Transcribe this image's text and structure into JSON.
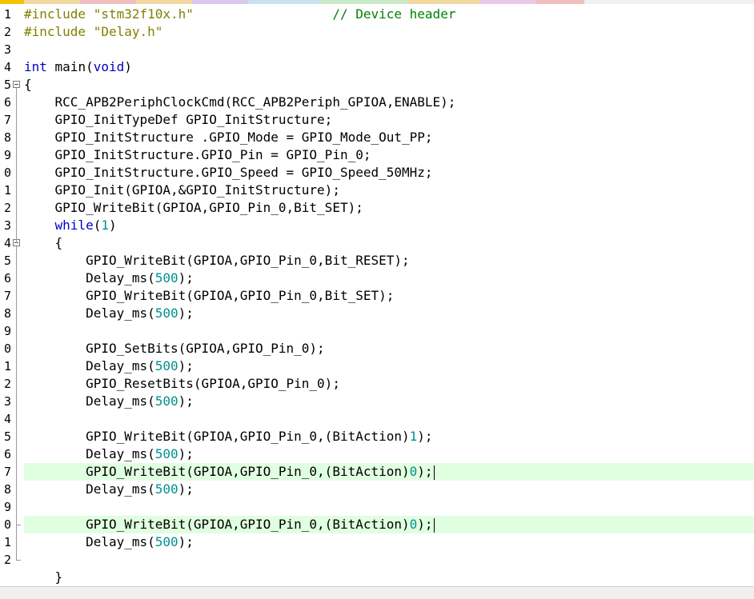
{
  "editor": {
    "lines": [
      {
        "n": "1",
        "parts": [
          {
            "t": "#include ",
            "c": "pp"
          },
          {
            "t": "\"stm32f10x.h\"",
            "c": "str"
          },
          {
            "t": "                  ",
            "c": ""
          },
          {
            "t": "// Device header",
            "c": "cm"
          }
        ]
      },
      {
        "n": "2",
        "parts": [
          {
            "t": "#include ",
            "c": "pp"
          },
          {
            "t": "\"Delay.h\"",
            "c": "str"
          }
        ]
      },
      {
        "n": "3",
        "parts": []
      },
      {
        "n": "4",
        "parts": [
          {
            "t": "int",
            "c": "kw"
          },
          {
            "t": " main(",
            "c": ""
          },
          {
            "t": "void",
            "c": "kw"
          },
          {
            "t": ")",
            "c": ""
          }
        ]
      },
      {
        "n": "5",
        "parts": [
          {
            "t": "{",
            "c": ""
          }
        ]
      },
      {
        "n": "6",
        "parts": [
          {
            "t": "    RCC_APB2PeriphClockCmd(RCC_APB2Periph_GPIOA,ENABLE);",
            "c": ""
          }
        ]
      },
      {
        "n": "7",
        "parts": [
          {
            "t": "    GPIO_InitTypeDef GPIO_InitStructure;",
            "c": ""
          }
        ]
      },
      {
        "n": "8",
        "parts": [
          {
            "t": "    GPIO_InitStructure .GPIO_Mode = GPIO_Mode_Out_PP;",
            "c": ""
          }
        ]
      },
      {
        "n": "9",
        "parts": [
          {
            "t": "    GPIO_InitStructure.GPIO_Pin = GPIO_Pin_0;",
            "c": ""
          }
        ]
      },
      {
        "n": "0",
        "parts": [
          {
            "t": "    GPIO_InitStructure.GPIO_Speed = GPIO_Speed_50MHz;",
            "c": ""
          }
        ]
      },
      {
        "n": "1",
        "parts": [
          {
            "t": "    GPIO_Init(GPIOA,&GPIO_InitStructure);",
            "c": ""
          }
        ]
      },
      {
        "n": "2",
        "parts": [
          {
            "t": "    GPIO_WriteBit(GPIOA,GPIO_Pin_0,Bit_SET);",
            "c": ""
          }
        ]
      },
      {
        "n": "3",
        "parts": [
          {
            "t": "    ",
            "c": ""
          },
          {
            "t": "while",
            "c": "kw"
          },
          {
            "t": "(",
            "c": ""
          },
          {
            "t": "1",
            "c": "num"
          },
          {
            "t": ")",
            "c": ""
          }
        ]
      },
      {
        "n": "4",
        "parts": [
          {
            "t": "    {",
            "c": ""
          }
        ]
      },
      {
        "n": "5",
        "parts": [
          {
            "t": "        GPIO_WriteBit(GPIOA,GPIO_Pin_0,Bit_RESET);",
            "c": ""
          }
        ]
      },
      {
        "n": "6",
        "parts": [
          {
            "t": "        Delay_ms(",
            "c": ""
          },
          {
            "t": "500",
            "c": "num"
          },
          {
            "t": ");",
            "c": ""
          }
        ]
      },
      {
        "n": "7",
        "parts": [
          {
            "t": "        GPIO_WriteBit(GPIOA,GPIO_Pin_0,Bit_SET);",
            "c": ""
          }
        ]
      },
      {
        "n": "8",
        "parts": [
          {
            "t": "        Delay_ms(",
            "c": ""
          },
          {
            "t": "500",
            "c": "num"
          },
          {
            "t": ");",
            "c": ""
          }
        ]
      },
      {
        "n": "9",
        "parts": []
      },
      {
        "n": "0",
        "parts": [
          {
            "t": "        GPIO_SetBits(GPIOA,GPIO_Pin_0);",
            "c": ""
          }
        ]
      },
      {
        "n": "1",
        "parts": [
          {
            "t": "        Delay_ms(",
            "c": ""
          },
          {
            "t": "500",
            "c": "num"
          },
          {
            "t": ");",
            "c": ""
          }
        ]
      },
      {
        "n": "2",
        "parts": [
          {
            "t": "        GPIO_ResetBits(GPIOA,GPIO_Pin_0);",
            "c": ""
          }
        ]
      },
      {
        "n": "3",
        "parts": [
          {
            "t": "        Delay_ms(",
            "c": ""
          },
          {
            "t": "500",
            "c": "num"
          },
          {
            "t": ");",
            "c": ""
          }
        ]
      },
      {
        "n": "4",
        "parts": []
      },
      {
        "n": "5",
        "parts": [
          {
            "t": "        GPIO_WriteBit(GPIOA,GPIO_Pin_0,(BitAction)",
            "c": ""
          },
          {
            "t": "1",
            "c": "num"
          },
          {
            "t": ");",
            "c": ""
          }
        ]
      },
      {
        "n": "6",
        "parts": [
          {
            "t": "        Delay_ms(",
            "c": ""
          },
          {
            "t": "500",
            "c": "num"
          },
          {
            "t": ");",
            "c": ""
          }
        ]
      },
      {
        "n": "7",
        "hl": true,
        "caret": true,
        "parts": [
          {
            "t": "        GPIO_WriteBit(GPIOA,GPIO_Pin_0,(BitAction)",
            "c": ""
          },
          {
            "t": "0",
            "c": "num"
          },
          {
            "t": ");",
            "c": ""
          }
        ]
      },
      {
        "n": "8",
        "parts": [
          {
            "t": "        Delay_ms(",
            "c": ""
          },
          {
            "t": "500",
            "c": "num"
          },
          {
            "t": ");",
            "c": ""
          }
        ]
      },
      {
        "n": "9",
        "parts": []
      },
      {
        "n": "0",
        "hl": true,
        "caret": true,
        "parts": [
          {
            "t": "        GPIO_WriteBit(GPIOA,GPIO_Pin_0,(BitAction)",
            "c": ""
          },
          {
            "t": "0",
            "c": "num"
          },
          {
            "t": ");",
            "c": ""
          }
        ]
      },
      {
        "n": "1",
        "parts": [
          {
            "t": "        Delay_ms(",
            "c": ""
          },
          {
            "t": "500",
            "c": "num"
          },
          {
            "t": ");",
            "c": ""
          }
        ]
      },
      {
        "n": "2",
        "parts": []
      },
      {
        "n": "",
        "parts": [
          {
            "t": "    }",
            "c": ""
          }
        ]
      }
    ]
  },
  "colors": {
    "keyword": "#0000c8",
    "preprocessor": "#808000",
    "comment": "#008000",
    "number": "#009090",
    "current_line": "#e0ffe0"
  },
  "icons": {
    "fold_main": "fold-minus-icon",
    "fold_while": "fold-minus-icon"
  }
}
